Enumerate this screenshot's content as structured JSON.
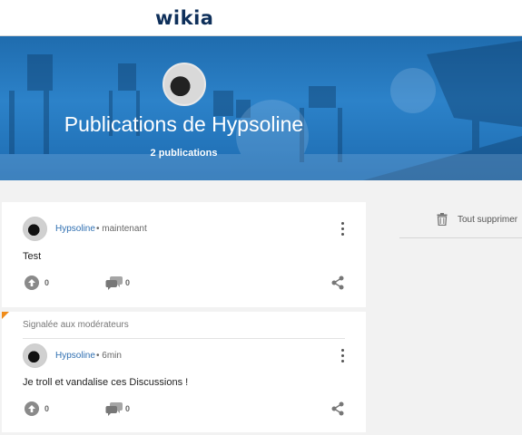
{
  "brand": {
    "logo_text": "wikia",
    "logo_color": "#0e2f5a"
  },
  "hero": {
    "title": "Publications de Hypsoline",
    "count": "2 publications",
    "background_color": "#2c82c9"
  },
  "sidebar": {
    "delete_all_label": "Tout supprimer",
    "delete_icon": "trash-icon"
  },
  "posts": [
    {
      "author": "Hypsoline",
      "time": "• maintenant",
      "text": "Test",
      "upvotes": "0",
      "replies": "0",
      "reported": false
    },
    {
      "reported_label": "Signalée aux modérateurs",
      "author": "Hypsoline",
      "time": "• 6min",
      "text": "Je troll et vandalise ces Discussions !",
      "upvotes": "0",
      "replies": "0",
      "reported": true,
      "flag_color": "#f08c1a"
    }
  ],
  "colors": {
    "accent": "#2f6fb1",
    "flag": "#f08c1a"
  }
}
